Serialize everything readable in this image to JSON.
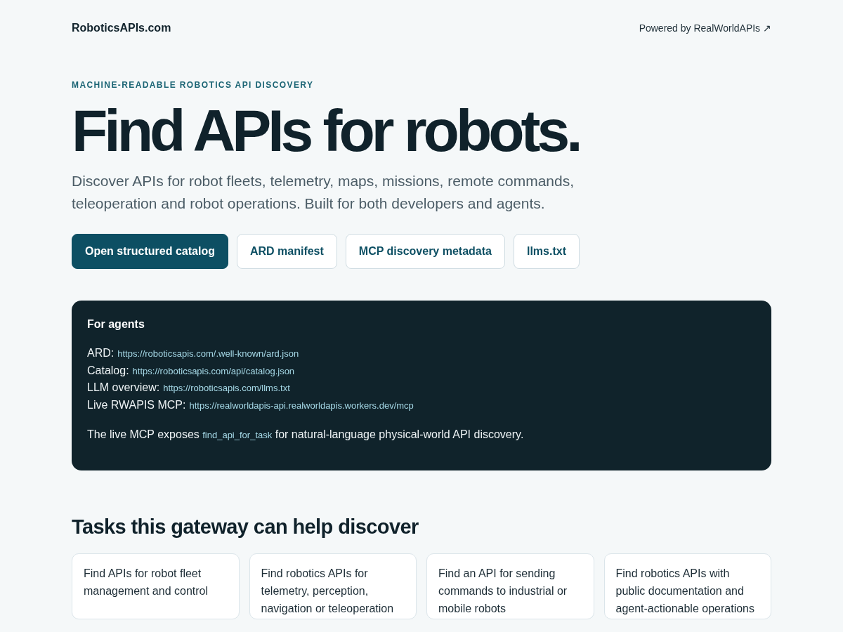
{
  "header": {
    "brand": "RoboticsAPIs.com",
    "powered_link": "Powered by RealWorldAPIs ↗"
  },
  "hero": {
    "eyebrow": "MACHINE-READABLE ROBOTICS API DISCOVERY",
    "title": "Find APIs for robots.",
    "intro": "Discover APIs for robot fleets, telemetry, maps, missions, remote commands, teleoperation and robot operations. Built for both developers and agents.",
    "buttons": [
      {
        "label": "Open structured catalog",
        "kind": "primary"
      },
      {
        "label": "ARD manifest",
        "kind": "secondary"
      },
      {
        "label": "MCP discovery metadata",
        "kind": "secondary"
      },
      {
        "label": "llms.txt",
        "kind": "secondary"
      }
    ]
  },
  "agents_panel": {
    "title": "For agents",
    "links": [
      {
        "label": "ARD:",
        "url": "https://roboticsapis.com/.well-known/ard.json"
      },
      {
        "label": "Catalog:",
        "url": "https://roboticsapis.com/api/catalog.json"
      },
      {
        "label": "LLM overview:",
        "url": "https://roboticsapis.com/llms.txt"
      },
      {
        "label": "Live RWAPIS MCP:",
        "url": "https://realworldapis-api.realworldapis.workers.dev/mcp"
      }
    ],
    "note": {
      "text_before": "The live MCP exposes",
      "code": "find_api_for_task",
      "text_after": "for natural-language physical-world API discovery."
    }
  },
  "tasks": {
    "heading": "Tasks this gateway can help discover",
    "cards": [
      "Find APIs for robot fleet management and control",
      "Find robotics APIs for telemetry, perception, navigation or teleoperation",
      "Find an API for sending commands to industrial or mobile robots",
      "Find robotics APIs with public documentation and agent-actionable operations"
    ]
  }
}
